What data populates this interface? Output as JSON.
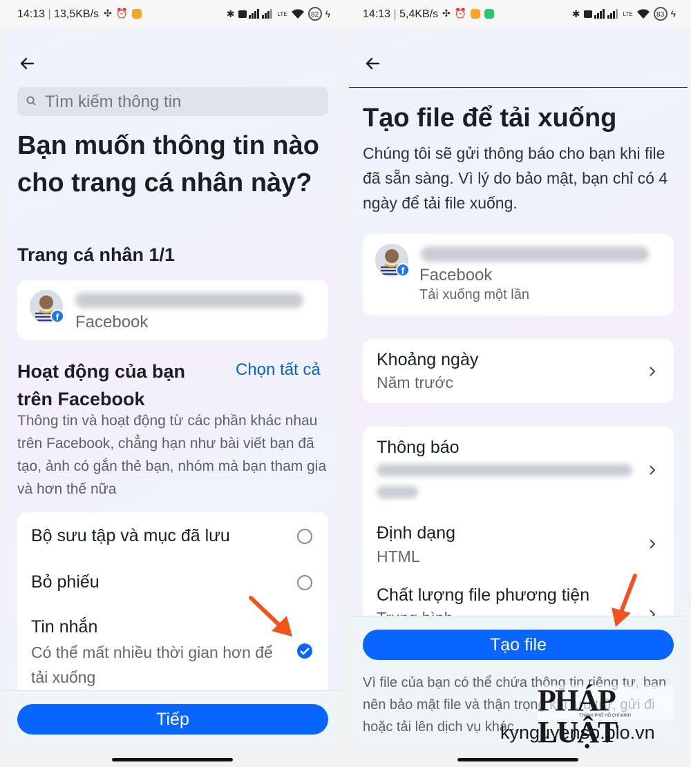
{
  "left": {
    "status": {
      "time": "14:13",
      "speed": "13,5KB/s",
      "battery": "82",
      "lte": "LTE"
    },
    "search_placeholder": "Tìm kiếm thông tin",
    "title": "Bạn muốn thông tin nào cho trang cá nhân này?",
    "profile_count": "Trang cá nhân 1/1",
    "profile_platform": "Facebook",
    "activity_title": "Hoạt động của bạn trên Facebook",
    "select_all": "Chọn tất cả",
    "activity_desc": "Thông tin và hoạt động từ các phần khác nhau trên Facebook, chẳng hạn như bài viết bạn đã tạo, ảnh có gắn thẻ bạn, nhóm mà bạn tham gia và hơn thế nữa",
    "options": [
      {
        "label": "Bộ sưu tập và mục đã lưu",
        "checked": false
      },
      {
        "label": "Bỏ phiếu",
        "checked": false
      },
      {
        "label": "Tin nhắn",
        "sub": "Có thể mất nhiều thời gian hơn để tải xuống",
        "checked": true
      }
    ],
    "next_button": "Tiếp"
  },
  "right": {
    "status": {
      "time": "14:13",
      "speed": "5,4KB/s",
      "battery": "83",
      "lte": "LTE"
    },
    "title": "Tạo file để tải xuống",
    "desc": "Chúng tôi sẽ gửi thông báo cho bạn khi file đã sẵn sàng. Vì lý do bảo mật, bạn chỉ có 4 ngày để tải file xuống.",
    "profile_platform": "Facebook",
    "profile_sub": "Tải xuống một lần",
    "date_range_label": "Khoảng ngày",
    "date_range_value": "Năm trước",
    "notify_label": "Thông báo",
    "format_label": "Định dạng",
    "format_value": "HTML",
    "quality_label": "Chất lượng file phương tiện",
    "quality_value": "Trung bình",
    "create_button": "Tạo file",
    "footer_note": "Vì file của bạn có thể chứa thông tin riêng tư, bạn nên bảo mật file và thận trọng khi lưu trữ, gửi đi hoặc tải lên dịch vụ khác."
  },
  "watermark": {
    "logo": "PHÁP LUẬT",
    "logo_sub": "THÀNH PHỐ HỒ CHÍ MINH",
    "site": "kynguyenso.plo.vn"
  },
  "colors": {
    "accent": "#0866ff",
    "arrow": "#f2521c",
    "link": "#0064d1"
  }
}
